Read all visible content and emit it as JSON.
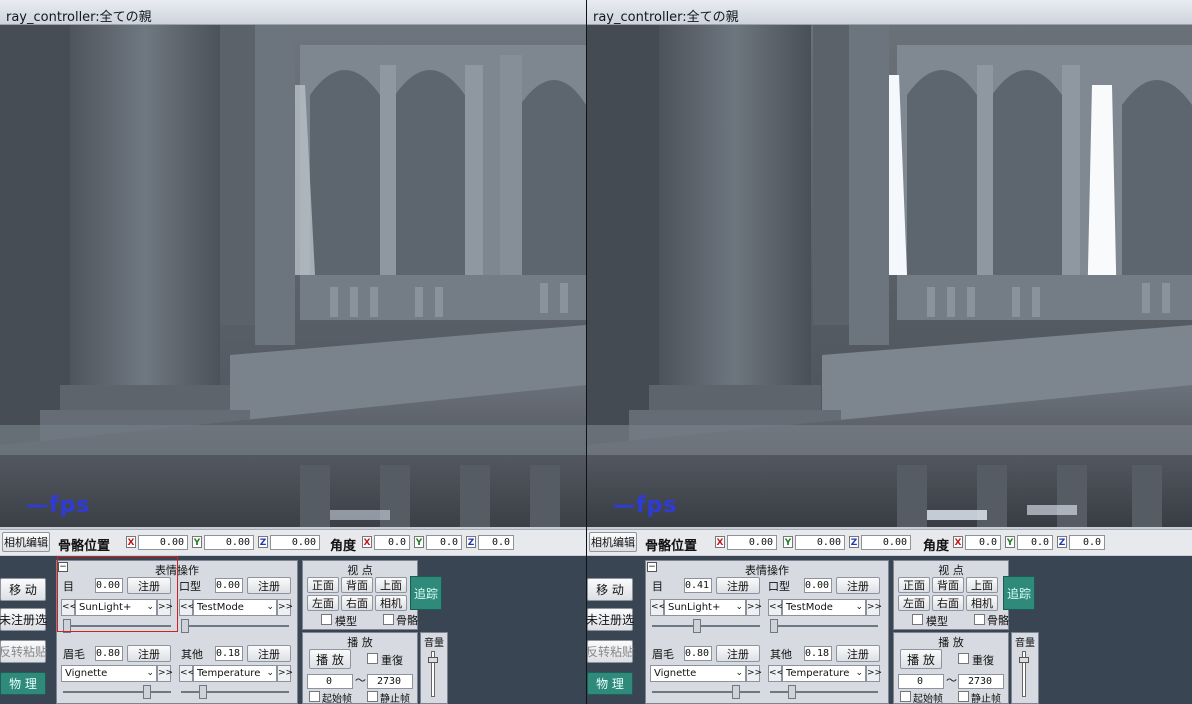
{
  "window_title": "ray_controller:全ての親",
  "fps_text": "—fps",
  "bone_bar": {
    "camera_edit": "相机编辑",
    "bone_position": "骨骼位置",
    "angle": "角度",
    "pos_x": "0.00",
    "pos_y": "0.00",
    "pos_z": "0.00",
    "ang_x": "0.0",
    "ang_y": "0.0",
    "ang_z": "0.0",
    "axis_x": "X",
    "axis_y": "Y",
    "axis_z": "Z"
  },
  "left_buttons": {
    "move": "移 动",
    "unregistered": "未注册选",
    "reverse_paste": "反转粘贴",
    "physics": "物 理"
  },
  "expression": {
    "title": "表情操作",
    "eye_label": "目",
    "mouth_label": "口型",
    "brow_label": "眉毛",
    "other_label": "其他",
    "register": "注册",
    "eye_select": "SunLight+",
    "mouth_select": "TestMode",
    "brow_select": "Vignette",
    "other_select": "Temperature",
    "prev": "<<",
    "next": ">>"
  },
  "views": [
    {
      "eye_value": "0.00",
      "mouth_value": "0.00",
      "brow_value": "0.80",
      "other_value": "0.18",
      "eye_slider": 0.0,
      "mouth_slider": 0.0,
      "brow_slider": 0.8,
      "other_slider": 0.18
    },
    {
      "eye_value": "0.41",
      "mouth_value": "0.00",
      "brow_value": "0.80",
      "other_value": "0.18",
      "eye_slider": 0.41,
      "mouth_slider": 0.0,
      "brow_slider": 0.8,
      "other_slider": 0.18
    }
  ],
  "viewpoint": {
    "title": "视 点",
    "front": "正面",
    "back": "背面",
    "top": "上面",
    "left": "左面",
    "right": "右面",
    "camera": "相机",
    "track": "追踪",
    "model": "模型",
    "bone": "骨骼"
  },
  "playback": {
    "title": "播 放",
    "play": "播 放",
    "repeat": "重復",
    "start": "0",
    "tilde": "〜",
    "end": "2730",
    "start_frame": "起始帧",
    "stop_frame": "静止帧"
  },
  "volume": {
    "title": "音量",
    "level": 0.85
  },
  "colors": {
    "accent_teal": "#2f8a7c",
    "fps_blue": "#2f3bd8",
    "highlight_red": "#d02020"
  }
}
